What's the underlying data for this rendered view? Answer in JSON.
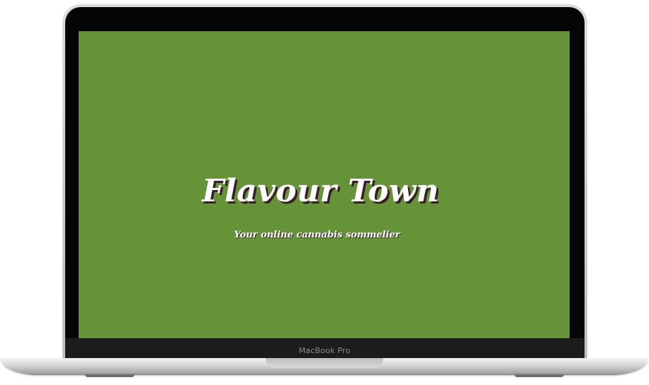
{
  "device": {
    "label": "MacBook Pro"
  },
  "hero": {
    "title": "Flavour Town",
    "subtitle": "Your online cannabis sommelier"
  },
  "colors": {
    "screen_background": "#679338",
    "title_text": "#ffffff",
    "title_shadow": "#3a1a2c",
    "bezel": "#050505"
  }
}
